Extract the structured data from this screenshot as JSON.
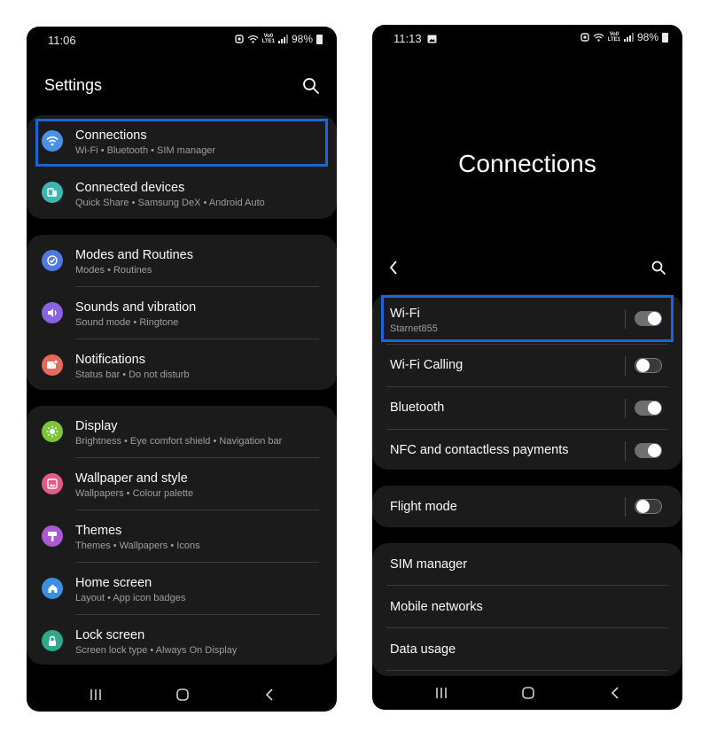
{
  "left_phone": {
    "status": {
      "time": "11:06",
      "volte": "Vo0\nLTE1",
      "battery": "98%"
    },
    "title": "Settings",
    "groups": [
      {
        "items": [
          {
            "title": "Connections",
            "subtitle": "Wi-Fi  •  Bluetooth  •  SIM manager",
            "icon": "wifi-icon",
            "color": "#4a8fe8",
            "highlighted": true
          },
          {
            "title": "Connected devices",
            "subtitle": "Quick Share  •  Samsung DeX  •  Android Auto",
            "icon": "connected-devices-icon",
            "color": "#3fb5b0"
          }
        ]
      },
      {
        "items": [
          {
            "title": "Modes and Routines",
            "subtitle": "Modes  •  Routines",
            "icon": "modes-routines-icon",
            "color": "#4f79e0"
          },
          {
            "title": "Sounds and vibration",
            "subtitle": "Sound mode  •  Ringtone",
            "icon": "sound-icon",
            "color": "#8a64e0"
          },
          {
            "title": "Notifications",
            "subtitle": "Status bar  •  Do not disturb",
            "icon": "notifications-icon",
            "color": "#e26b5b"
          }
        ]
      },
      {
        "items": [
          {
            "title": "Display",
            "subtitle": "Brightness  •  Eye comfort shield  •  Navigation bar",
            "icon": "display-icon",
            "color": "#7dc43a"
          },
          {
            "title": "Wallpaper and style",
            "subtitle": "Wallpapers  •  Colour palette",
            "icon": "wallpaper-icon",
            "color": "#e45b87"
          },
          {
            "title": "Themes",
            "subtitle": "Themes  •  Wallpapers  •  Icons",
            "icon": "themes-icon",
            "color": "#a95ad0"
          },
          {
            "title": "Home screen",
            "subtitle": "Layout  •  App icon badges",
            "icon": "home-screen-icon",
            "color": "#3a8fe0"
          },
          {
            "title": "Lock screen",
            "subtitle": "Screen lock type  •  Always On Display",
            "icon": "lock-screen-icon",
            "color": "#2fa88c"
          }
        ]
      }
    ]
  },
  "right_phone": {
    "status": {
      "time": "11:13",
      "volte": "Vo0\nLTE1",
      "battery": "98%"
    },
    "title": "Connections",
    "groups": [
      {
        "items": [
          {
            "title": "Wi-Fi",
            "subtitle": "Starnet855",
            "toggle": true,
            "on": true,
            "highlighted": true
          },
          {
            "title": "Wi-Fi Calling",
            "toggle": true,
            "on": false
          },
          {
            "title": "Bluetooth",
            "toggle": true,
            "on": true
          },
          {
            "title": "NFC and contactless payments",
            "toggle": true,
            "on": true
          }
        ]
      },
      {
        "items": [
          {
            "title": "Flight mode",
            "toggle": true,
            "on": false
          }
        ]
      },
      {
        "items": [
          {
            "title": "SIM manager"
          },
          {
            "title": "Mobile networks"
          },
          {
            "title": "Data usage"
          }
        ]
      }
    ]
  },
  "nav": {
    "recents": "|||",
    "home": "○",
    "back": "‹"
  },
  "accent_highlight": "#1a66d6"
}
